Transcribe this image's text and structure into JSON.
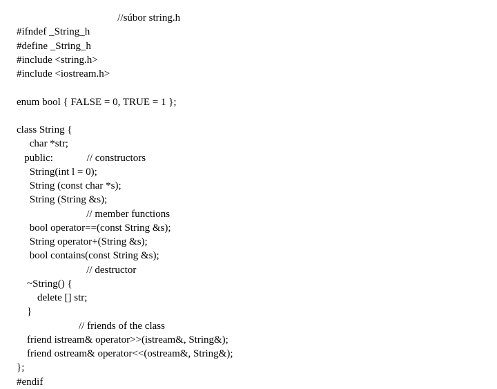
{
  "lines": {
    "l0": "                                       //súbor string.h",
    "l1": "#ifndef _String_h",
    "l2": "#define _String_h",
    "l3": "#include <string.h>",
    "l4": "#include <iostream.h>",
    "l5": "",
    "l6": "enum bool { FALSE = 0, TRUE = 1 };",
    "l7": "",
    "l8": "class String {",
    "l9": "     char *str;",
    "l10": "   public:             // constructors",
    "l11": "     String(int l = 0);",
    "l12": "     String (const char *s);",
    "l13": "     String (String &s);",
    "l14": "                           // member functions",
    "l15": "     bool operator==(const String &s);",
    "l16": "     String operator+(String &s);",
    "l17": "     bool contains(const String &s);",
    "l18": "                           // destructor",
    "l19": "    ~String() {",
    "l20": "        delete [] str;",
    "l21": "    }",
    "l22": "                        // friends of the class",
    "l23": "    friend istream& operator>>(istream&, String&);",
    "l24": "    friend ostream& operator<<(ostream&, String&);",
    "l25": "};",
    "l26": "#endif"
  }
}
